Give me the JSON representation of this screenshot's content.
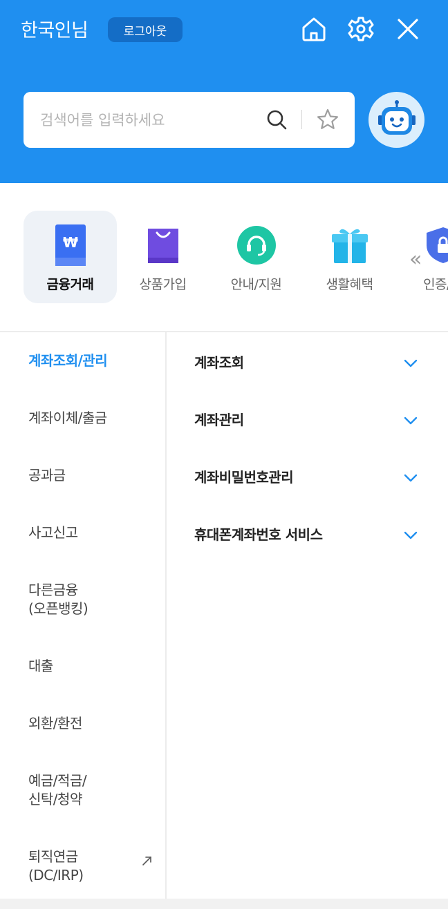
{
  "header": {
    "user_name": "한국인님",
    "logout_label": "로그아웃",
    "bg_color": "#1f8ff0",
    "icons": [
      "home-icon",
      "gear-icon",
      "close-icon"
    ]
  },
  "search": {
    "placeholder": "검색어를 입력하세요",
    "value": ""
  },
  "categories": [
    {
      "label": "금융거래",
      "icon": "won-card-icon",
      "active": true
    },
    {
      "label": "상품가입",
      "icon": "shopping-bag-icon",
      "active": false
    },
    {
      "label": "안내/지원",
      "icon": "headset-icon",
      "active": false
    },
    {
      "label": "생활혜택",
      "icon": "gift-icon",
      "active": false
    },
    {
      "label": "인증/보",
      "icon": "shield-lock-icon",
      "active": false
    }
  ],
  "left_menu": [
    {
      "label": "계좌조회/관리",
      "active": true
    },
    {
      "label": "계좌이체/출금",
      "active": false
    },
    {
      "label": "공과금",
      "active": false
    },
    {
      "label": "사고신고",
      "active": false
    },
    {
      "label": "다른금융\n(오픈뱅킹)",
      "active": false
    },
    {
      "label": "대출",
      "active": false
    },
    {
      "label": "외환/환전",
      "active": false
    },
    {
      "label": "예금/적금/\n신탁/청약",
      "active": false
    },
    {
      "label": "퇴직연금\n(DC/IRP)",
      "active": false,
      "external": true
    }
  ],
  "sub_menu": [
    {
      "label": "계좌조회"
    },
    {
      "label": "계좌관리"
    },
    {
      "label": "계좌비밀번호관리"
    },
    {
      "label": "휴대폰계좌번호 서비스"
    }
  ],
  "accent_color": "#1f8ff0"
}
